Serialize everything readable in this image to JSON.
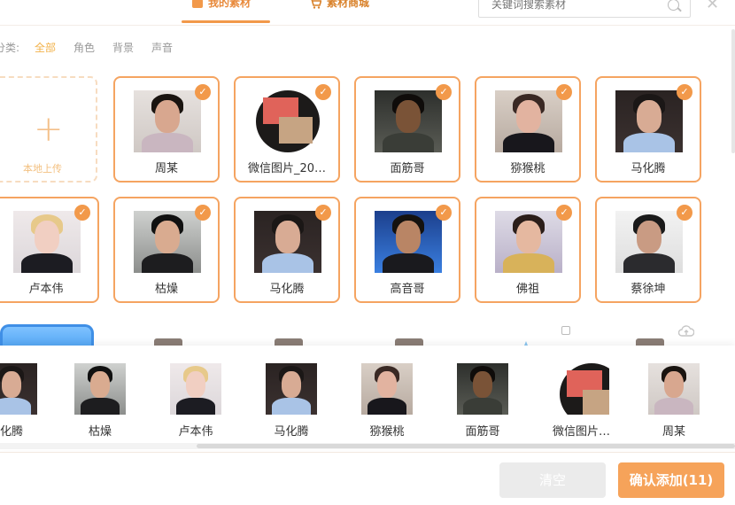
{
  "tabs": {
    "mine": "我的素材",
    "store": "素材商城"
  },
  "search": {
    "placeholder": "关键词搜索素材"
  },
  "categories": {
    "prefix": "分类:",
    "items": [
      "全部",
      "角色",
      "背景",
      "声音"
    ],
    "active": "全部"
  },
  "upload": {
    "label": "本地上传"
  },
  "grid": [
    {
      "name": "周某",
      "thumb": "zhou"
    },
    {
      "name": "微信图片_20…",
      "thumb": "wechat"
    },
    {
      "name": "面筋哥",
      "thumb": "mianjin"
    },
    {
      "name": "猕猴桃",
      "thumb": "mihoutao"
    },
    {
      "name": "马化腾",
      "thumb": "ma"
    },
    {
      "name": "卢本伟",
      "thumb": "lu"
    },
    {
      "name": "枯燥",
      "thumb": "kuzao"
    },
    {
      "name": "马化腾",
      "thumb": "ma"
    },
    {
      "name": "高音哥",
      "thumb": "gaoyin"
    },
    {
      "name": "佛祖",
      "thumb": "fozu"
    },
    {
      "name": "蔡徐坤",
      "thumb": "cai"
    }
  ],
  "selected": [
    {
      "name": "化腾",
      "thumb": "ma"
    },
    {
      "name": "枯燥",
      "thumb": "kuzao"
    },
    {
      "name": "卢本伟",
      "thumb": "lu"
    },
    {
      "name": "马化腾",
      "thumb": "ma"
    },
    {
      "name": "猕猴桃",
      "thumb": "mihoutao"
    },
    {
      "name": "面筋哥",
      "thumb": "mianjin"
    },
    {
      "name": "微信图片_…",
      "thumb": "wechat"
    },
    {
      "name": "周某",
      "thumb": "zhou"
    }
  ],
  "buttons": {
    "clear": "清空",
    "confirm": "确认添加(11)"
  },
  "colors": {
    "accent": "#f2994a",
    "card_border": "#f5a461",
    "confirm_bg": "#f6a35a",
    "clear_bg": "#ebebeb"
  },
  "icons": {
    "mine_tab": "folder-icon",
    "store_tab": "cart-icon",
    "search": "search-icon",
    "close": "close-icon",
    "check": "check-icon",
    "upload": "plus-icon"
  }
}
